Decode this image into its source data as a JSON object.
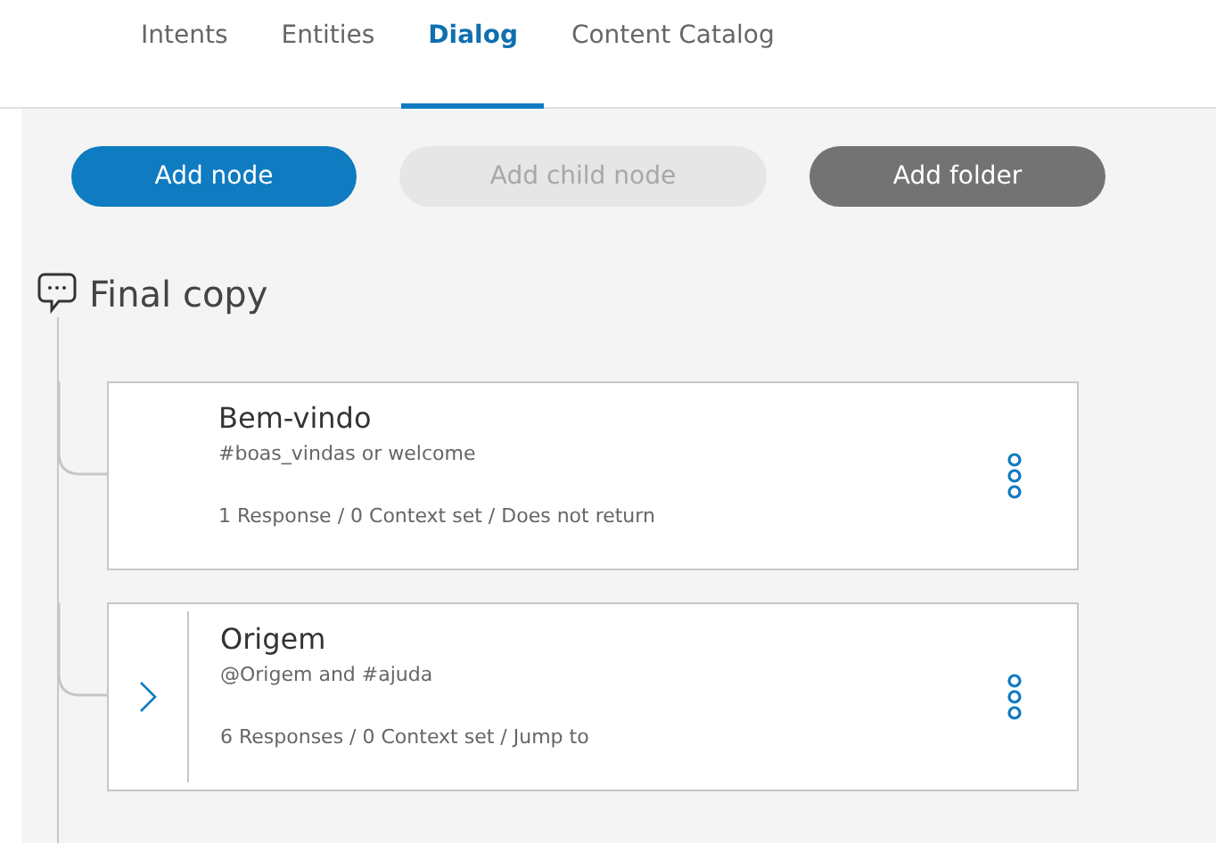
{
  "tabs": [
    {
      "label": "Intents",
      "selected": false
    },
    {
      "label": "Entities",
      "selected": false
    },
    {
      "label": "Dialog",
      "selected": true
    },
    {
      "label": "Content Catalog",
      "selected": false
    }
  ],
  "buttons": [
    {
      "label": "Add node",
      "kind": "primary",
      "disabled": false
    },
    {
      "label": "Add child node",
      "kind": "primary",
      "disabled": true
    },
    {
      "label": "Add folder",
      "kind": "secondary",
      "disabled": false
    }
  ],
  "dialog": {
    "title": "Final copy"
  },
  "nodes": [
    {
      "title": "Bem-vindo",
      "condition": "#boas_vindas or welcome",
      "summary": "1 Response / 0 Context set / Does not return",
      "has_children": false
    },
    {
      "title": "Origem",
      "condition": "@Origem and #ajuda",
      "summary": "6 Responses / 0 Context set / Jump to",
      "has_children": true
    }
  ]
}
